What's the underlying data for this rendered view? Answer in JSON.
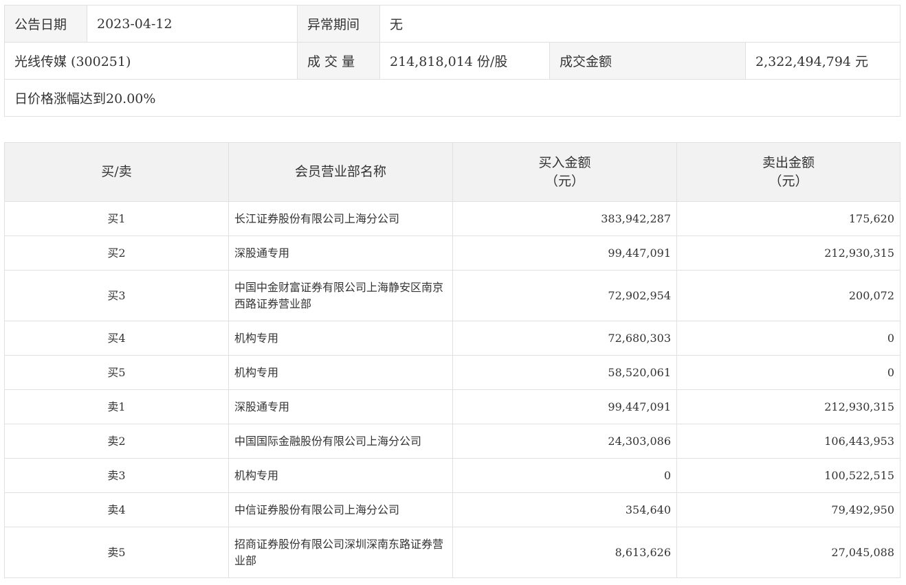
{
  "info": {
    "date_label": "公告日期",
    "date_value": "2023-04-12",
    "anomaly_label": "异常期间",
    "anomaly_value": "无",
    "stock_label": "光线传媒 (300251)",
    "volume_label": "成 交 量",
    "volume_value": "214,818,014 份/股",
    "amount_label": "成交金额",
    "amount_value": "2,322,494,794 元",
    "reason": "日价格涨幅达到20.00%"
  },
  "table": {
    "headers": {
      "side": "买/卖",
      "name": "会员营业部名称",
      "buy": "买入金额",
      "buy_unit": "（元）",
      "sell": "卖出金额",
      "sell_unit": "（元）"
    },
    "rows": [
      {
        "side": "买1",
        "name": "长江证券股份有限公司上海分公司",
        "buy": "383,942,287",
        "sell": "175,620"
      },
      {
        "side": "买2",
        "name": "深股通专用",
        "buy": "99,447,091",
        "sell": "212,930,315"
      },
      {
        "side": "买3",
        "name": "中国中金财富证券有限公司上海静安区南京西路证券营业部",
        "buy": "72,902,954",
        "sell": "200,072"
      },
      {
        "side": "买4",
        "name": "机构专用",
        "buy": "72,680,303",
        "sell": "0"
      },
      {
        "side": "买5",
        "name": "机构专用",
        "buy": "58,520,061",
        "sell": "0"
      },
      {
        "side": "卖1",
        "name": "深股通专用",
        "buy": "99,447,091",
        "sell": "212,930,315"
      },
      {
        "side": "卖2",
        "name": "中国国际金融股份有限公司上海分公司",
        "buy": "24,303,086",
        "sell": "106,443,953"
      },
      {
        "side": "卖3",
        "name": "机构专用",
        "buy": "0",
        "sell": "100,522,515"
      },
      {
        "side": "卖4",
        "name": "中信证券股份有限公司上海分公司",
        "buy": "354,640",
        "sell": "79,492,950"
      },
      {
        "side": "卖5",
        "name": "招商证券股份有限公司深圳深南东路证券营业部",
        "buy": "8,613,626",
        "sell": "27,045,088"
      }
    ]
  }
}
